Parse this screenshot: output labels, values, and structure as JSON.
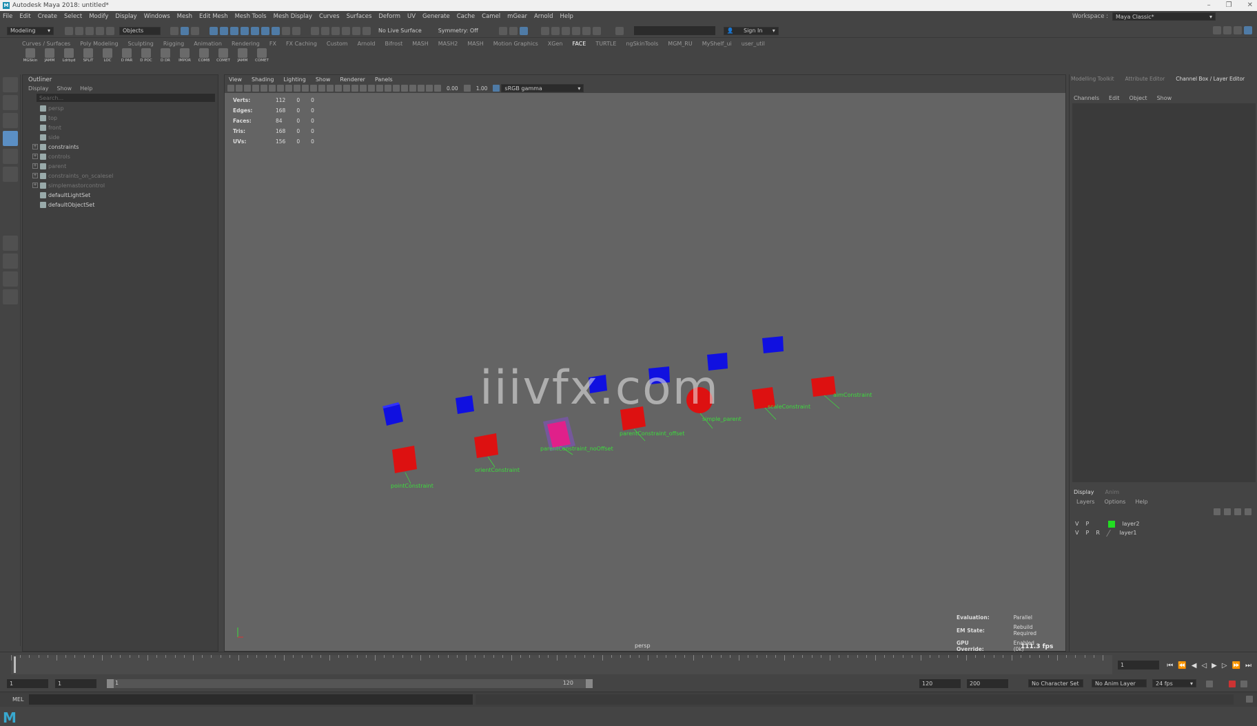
{
  "window": {
    "title": "Autodesk Maya 2018: untitled*",
    "controls": [
      "–",
      "❐",
      "✕"
    ]
  },
  "menubar": [
    "File",
    "Edit",
    "Create",
    "Select",
    "Modify",
    "Display",
    "Windows",
    "Mesh",
    "Edit Mesh",
    "Mesh Tools",
    "Mesh Display",
    "Curves",
    "Surfaces",
    "Deform",
    "UV",
    "Generate",
    "Cache",
    "Camel",
    "mGear",
    "Arnold",
    "Help"
  ],
  "workspace": {
    "label": "Workspace :",
    "value": "Maya Classic*"
  },
  "statusline": {
    "mode": "Modeling",
    "objects": "Objects",
    "live_surface": "No Live Surface",
    "symmetry": "Symmetry: Off",
    "sign_in": "Sign In"
  },
  "shelf": {
    "tabs": [
      "Curves / Surfaces",
      "Poly Modeling",
      "Sculpting",
      "Rigging",
      "Animation",
      "Rendering",
      "FX",
      "FX Caching",
      "Custom",
      "Arnold",
      "Bifrost",
      "MASH",
      "MASH2",
      "MASH",
      "Motion Graphics",
      "XGen",
      "FACE",
      "TURTLE",
      "ngSkinTools",
      "MGM_RU",
      "MyShelf_ui",
      "user_util"
    ],
    "active_tab": "FACE",
    "icons": [
      "MGSkin",
      "JAMM",
      "Ldrbyd",
      "SPLIT",
      "LOC",
      "D PAR",
      "D POC",
      "D DR",
      "IMPOR",
      "COMB",
      "COMET",
      "JAMM",
      "COMET"
    ]
  },
  "outliner": {
    "title": "Outliner",
    "menu": [
      "Display",
      "Show",
      "Help"
    ],
    "search_placeholder": "Search...",
    "items": [
      {
        "label": "persp",
        "dim": true,
        "expand": false
      },
      {
        "label": "top",
        "dim": true,
        "expand": false
      },
      {
        "label": "front",
        "dim": true,
        "expand": false
      },
      {
        "label": "side",
        "dim": true,
        "expand": false
      },
      {
        "label": "constraints",
        "dim": false,
        "expand": true
      },
      {
        "label": "controls",
        "dim": true,
        "expand": true
      },
      {
        "label": "parent",
        "dim": true,
        "expand": true
      },
      {
        "label": "constraints_on_scalesel",
        "dim": true,
        "expand": true
      },
      {
        "label": "simplemastorcontrol",
        "dim": true,
        "expand": true
      },
      {
        "label": "defaultLightSet",
        "dim": false,
        "expand": false
      },
      {
        "label": "defaultObjectSet",
        "dim": false,
        "expand": false
      }
    ]
  },
  "viewport": {
    "menu": [
      "View",
      "Shading",
      "Lighting",
      "Show",
      "Renderer",
      "Panels"
    ],
    "exposure": "0.00",
    "gamma": "1.00",
    "colorspace": "sRGB gamma",
    "hud": [
      {
        "k": "Verts:",
        "a": "112",
        "b": "0",
        "c": "0"
      },
      {
        "k": "Edges:",
        "a": "168",
        "b": "0",
        "c": "0"
      },
      {
        "k": "Faces:",
        "a": "84",
        "b": "0",
        "c": "0"
      },
      {
        "k": "Tris:",
        "a": "168",
        "b": "0",
        "c": "0"
      },
      {
        "k": "UVs:",
        "a": "156",
        "b": "0",
        "c": "0"
      }
    ],
    "camera": "persp",
    "eval": [
      {
        "k": "Evaluation:",
        "v": "Parallel"
      },
      {
        "k": "EM State:",
        "v": "Rebuild Required"
      },
      {
        "k": "GPU Override:",
        "v": "Enabled (0k)"
      }
    ],
    "fps": "111.3 fps",
    "watermark": "iiivfx.com",
    "labels": [
      "pointConstraint",
      "orientConstraint",
      "parentConstraint_noOffset",
      "parentConstraint_offset",
      "simple_parent",
      "scaleConstraint",
      "aimConstraint"
    ]
  },
  "rightpanel": {
    "tabs": [
      "Modelling Toolkit",
      "Attribute Editor",
      "Channel Box / Layer Editor"
    ],
    "active": "Channel Box / Layer Editor",
    "cb_menu": [
      "Channels",
      "Edit",
      "Object",
      "Show"
    ],
    "layer_tabs": [
      "Display",
      "Anim"
    ],
    "layer_menu": [
      "Layers",
      "Options",
      "Help"
    ],
    "layers": [
      {
        "v": "V",
        "p": "P",
        "r": "",
        "name": "layer2",
        "color": "#22dd22"
      },
      {
        "v": "V",
        "p": "P",
        "r": "R",
        "name": "layer1",
        "color": ""
      }
    ]
  },
  "timeline": {
    "current": "1"
  },
  "range": {
    "start": "1",
    "start2": "1",
    "slider_start": "1",
    "slider_end": "120",
    "end": "120",
    "end2": "200",
    "char_set": "No Character Set",
    "anim_layer": "No Anim Layer",
    "fps": "24 fps"
  },
  "cmdline": {
    "lang": "MEL"
  }
}
